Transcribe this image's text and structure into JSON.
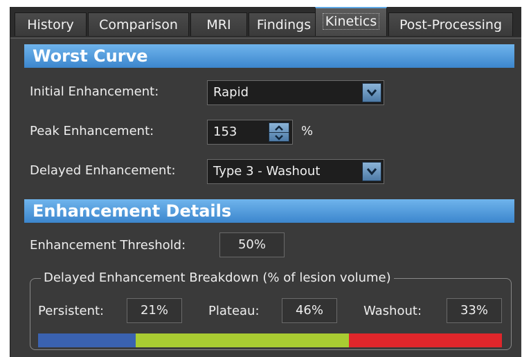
{
  "tabs": [
    {
      "label": "History"
    },
    {
      "label": "Comparison"
    },
    {
      "label": "MRI"
    },
    {
      "label": "Findings"
    },
    {
      "label": "Kinetics"
    },
    {
      "label": "Post-Processing"
    }
  ],
  "active_tab": "Kinetics",
  "worst_curve": {
    "title": "Worst Curve",
    "initial_label": "Initial Enhancement:",
    "initial_value": "Rapid",
    "peak_label": "Peak Enhancement:",
    "peak_value": "153",
    "peak_unit": "%",
    "delayed_label": "Delayed Enhancement:",
    "delayed_value": "Type 3 - Washout"
  },
  "details": {
    "title": "Enhancement Details",
    "threshold_label": "Enhancement Threshold:",
    "threshold_value": "50%",
    "breakdown_title": "Delayed Enhancement Breakdown (% of lesion volume)",
    "persistent_label": "Persistent:",
    "persistent_value": "21%",
    "plateau_label": "Plateau:",
    "plateau_value": "46%",
    "washout_label": "Washout:",
    "washout_value": "33%"
  },
  "breakdown_bar": {
    "persistent_fraction": 0.21,
    "plateau_fraction": 0.46,
    "washout_fraction": 0.33,
    "persistent_color": "#3a62b0",
    "plateau_color": "#a9cc32",
    "washout_color": "#e0262b"
  },
  "colors": {
    "section_header": "#4a94d8",
    "background": "#3a3a3a",
    "active_tab_accent": "#5fa8e6"
  }
}
